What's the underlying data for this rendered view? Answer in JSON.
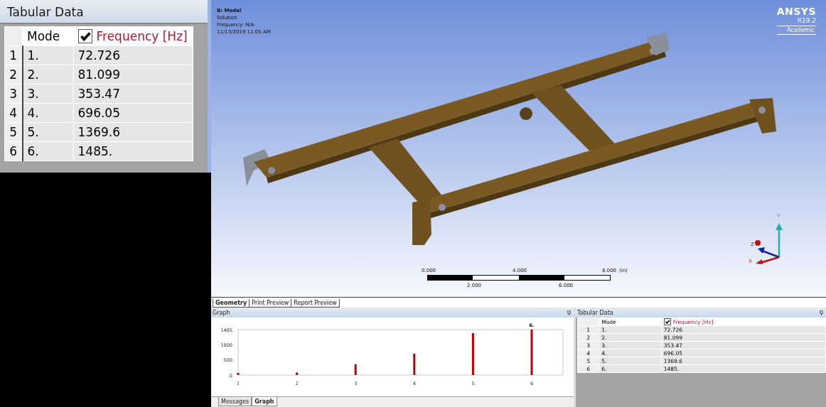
{
  "zoomed_table": {
    "title": "Tabular Data",
    "columns": [
      {
        "label": "Mode"
      },
      {
        "label": "Frequency [Hz]",
        "checked": true
      }
    ],
    "rows": [
      {
        "index": "1",
        "mode": "1.",
        "frequency": "72.726"
      },
      {
        "index": "2",
        "mode": "2.",
        "frequency": "81.099"
      },
      {
        "index": "3",
        "mode": "3.",
        "frequency": "353.47"
      },
      {
        "index": "4",
        "mode": "4.",
        "frequency": "696.05"
      },
      {
        "index": "5",
        "mode": "5.",
        "frequency": "1369.6"
      },
      {
        "index": "6",
        "mode": "6.",
        "frequency": "1485."
      }
    ]
  },
  "viewport": {
    "title": "B: Modal",
    "info_lines": [
      "Solution",
      "Frequency: N/A",
      "11/13/2019 11:05 AM"
    ],
    "logo": {
      "name": "ANSYS",
      "version": "R19.2",
      "edition": "Academic"
    },
    "scale_bar": {
      "top_labels": [
        "0.000",
        "4.000",
        "8.000"
      ],
      "unit": "(in)",
      "bottom_labels": [
        "2.000",
        "6.000"
      ]
    },
    "triad": {
      "y": "Y",
      "z": "Z",
      "x": "X"
    }
  },
  "view_tabs": [
    {
      "label": "Geometry",
      "selected": true
    },
    {
      "label": "Print Preview",
      "selected": false
    },
    {
      "label": "Report Preview",
      "selected": false
    }
  ],
  "graph_panel": {
    "title": "Graph",
    "chart_data": {
      "type": "bar",
      "categories": [
        "1",
        "2",
        "3",
        "4",
        "5",
        "6"
      ],
      "values": [
        73,
        81,
        353,
        696,
        1370,
        1485
      ],
      "ylim": [
        0,
        1485
      ],
      "yticks": [
        {
          "value": 0,
          "label": "0."
        },
        {
          "value": 500,
          "label": "500."
        },
        {
          "value": 1000,
          "label": "1000."
        },
        {
          "value": 1485,
          "label": "1485."
        }
      ],
      "annotations": [
        "6."
      ]
    },
    "tabs": [
      {
        "label": "Messages",
        "selected": false
      },
      {
        "label": "Graph",
        "selected": true
      }
    ]
  },
  "tabular_panel": {
    "title": "Tabular Data",
    "columns": [
      {
        "label": "Mode"
      },
      {
        "label": "Frequency [Hz]",
        "checked": true
      }
    ],
    "rows": [
      {
        "index": "1",
        "mode": "1.",
        "frequency": "72.726"
      },
      {
        "index": "2",
        "mode": "2.",
        "frequency": "81.099"
      },
      {
        "index": "3",
        "mode": "3.",
        "frequency": "353.47"
      },
      {
        "index": "4",
        "mode": "4.",
        "frequency": "696.05"
      },
      {
        "index": "5",
        "mode": "5.",
        "frequency": "1369.6"
      },
      {
        "index": "6",
        "mode": "6.",
        "frequency": "1485."
      }
    ]
  }
}
